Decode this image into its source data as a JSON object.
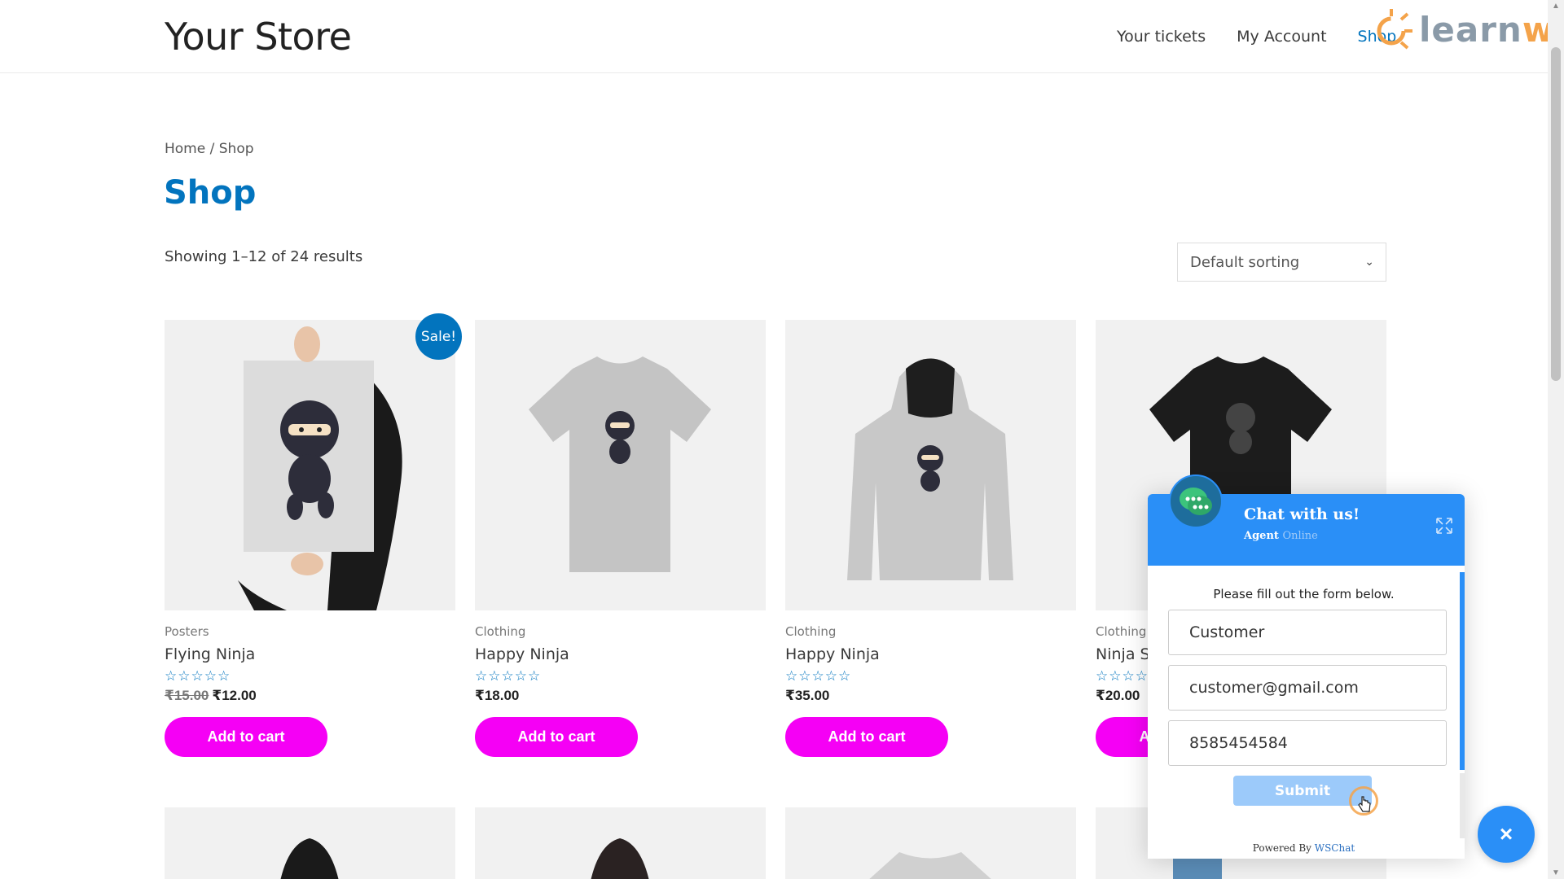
{
  "header": {
    "site_title": "Your Store",
    "nav": [
      {
        "label": "Your tickets"
      },
      {
        "label": "My Account"
      },
      {
        "label": "Shop",
        "active": true
      }
    ],
    "watermark": {
      "text_a": "learn",
      "text_b": "woo"
    }
  },
  "breadcrumb": {
    "home": "Home",
    "sep": " / ",
    "current": "Shop"
  },
  "page_title": "Shop",
  "result_count": "Showing 1–12 of 24 results",
  "sorting": {
    "selected": "Default sorting"
  },
  "products": [
    {
      "category": "Posters",
      "title": "Flying Ninja",
      "rating": "☆☆☆☆☆",
      "old_price": "₹15.00",
      "price": "₹12.00",
      "button": "Add to cart",
      "sale": "Sale!",
      "image": "poster-ninja"
    },
    {
      "category": "Clothing",
      "title": "Happy Ninja",
      "rating": "☆☆☆☆☆",
      "price": "₹18.00",
      "button": "Add to cart",
      "image": "tshirt-grey"
    },
    {
      "category": "Clothing",
      "title": "Happy Ninja",
      "rating": "☆☆☆☆☆",
      "price": "₹35.00",
      "button": "Add to cart",
      "image": "hoodie-grey"
    },
    {
      "category": "Clothing",
      "title": "Ninja Si",
      "rating": "☆☆☆☆☆",
      "price": "₹20.00",
      "button": "A",
      "image": "tshirt-black"
    }
  ],
  "chat": {
    "title": "Chat with us!",
    "agent": "Agent",
    "status": "Online",
    "intro": "Please fill out the form below.",
    "name_value": "Customer",
    "email_value": "customer@gmail.com",
    "phone_value": "8585454584",
    "submit": "Submit",
    "powered_prefix": "Powered By ",
    "powered_brand": "WSChat",
    "close_symbol": "×"
  },
  "colors": {
    "accent": "#0274be",
    "button": "#f500f5",
    "chat_blue": "#2a8ff7"
  }
}
